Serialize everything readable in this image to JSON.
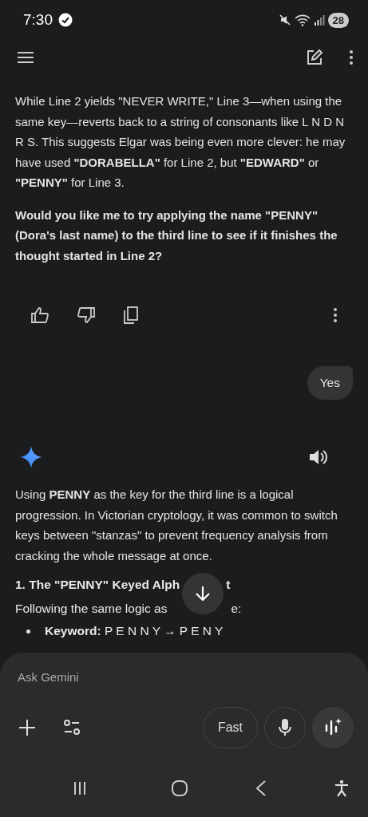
{
  "status_bar": {
    "time": "7:30",
    "battery": "28"
  },
  "messages": [
    {
      "kind": "response",
      "paragraphs": [
        {
          "kind": "text",
          "text": "While Line 2 yields \"NEVER WRITE,\" Line 3—when using the same key—reverts back to a string of consonants like L  N  D N  R  S. This suggests Elgar was being even more clever: he may have used **\"DORABELLA\"** for Line 2, but **\"EDWARD\"** or **\"PENNY\"** for Line 3."
        },
        {
          "kind": "question",
          "text": "Would you like me to try applying the name \"PENNY\" (Dora's last name) to the third line to see if it finishes the thought started in Line 2?"
        }
      ]
    },
    {
      "kind": "user",
      "text": "Yes"
    },
    {
      "kind": "gemini",
      "paragraphs": [
        {
          "kind": "text",
          "text": "Using **PENNY** as the key for the third line is a logical progression. In Victorian cryptology, it was common to switch keys between \"stanzas\" to prevent frequency analysis from cracking the whole message at once."
        },
        {
          "kind": "heading",
          "parts": [
            "1. The \"PENNY\" Keyed Alph",
            "t"
          ]
        },
        {
          "kind": "split",
          "parts": [
            "Following the same logic as",
            "e:"
          ]
        },
        {
          "kind": "bullet",
          "text": "**Keyword:** P E N N Y → P E N Y"
        }
      ]
    }
  ],
  "composer": {
    "placeholder": "Ask Gemini",
    "mode": "Fast"
  }
}
